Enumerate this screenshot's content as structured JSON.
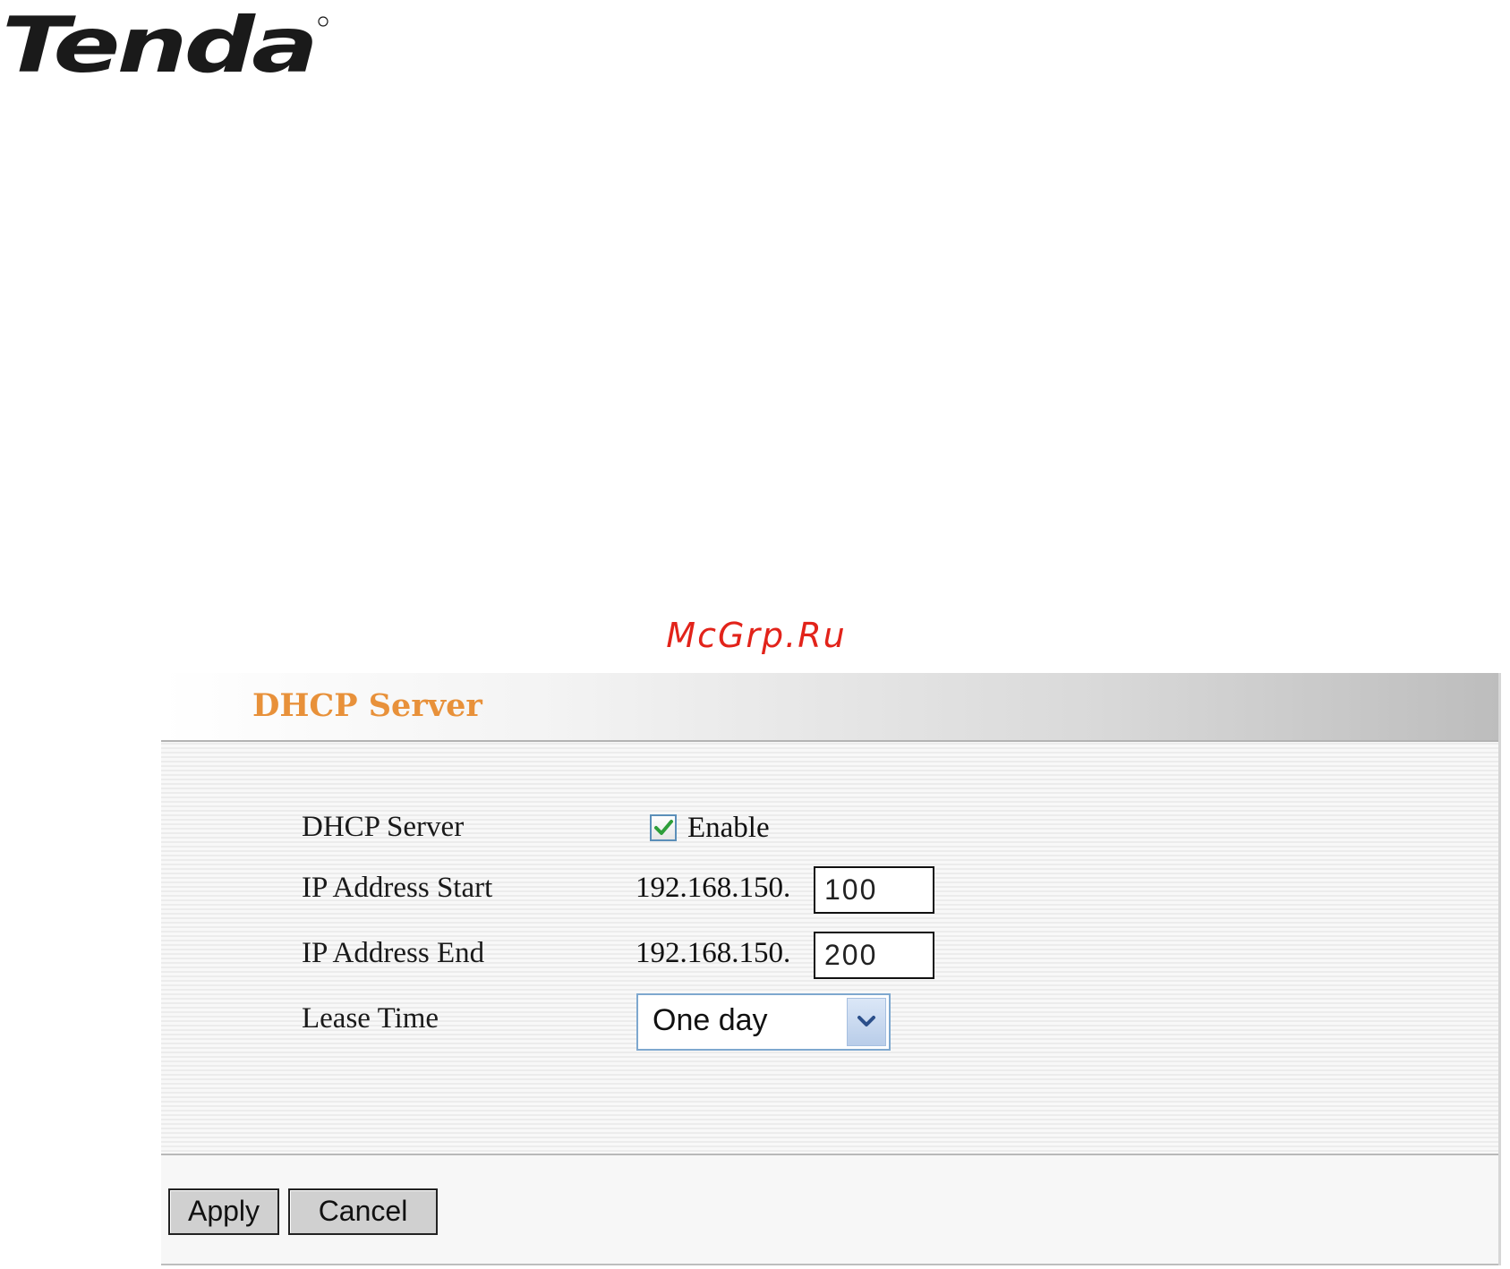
{
  "brand": {
    "logo_text": "Tenda",
    "watermark": "McGrp.Ru"
  },
  "panel": {
    "title": "DHCP Server"
  },
  "form": {
    "dhcp_server": {
      "label": "DHCP Server",
      "checked": true,
      "option_label": "Enable"
    },
    "ip_start": {
      "label": "IP Address Start",
      "prefix": "192.168.150.",
      "value": "100"
    },
    "ip_end": {
      "label": "IP Address End",
      "prefix": "192.168.150.",
      "value": "200"
    },
    "lease_time": {
      "label": "Lease Time",
      "selected": "One day"
    }
  },
  "buttons": {
    "apply": "Apply",
    "cancel": "Cancel"
  },
  "colors": {
    "title": "#e8913a",
    "watermark": "#e2231a",
    "check": "#2e9e3a"
  }
}
